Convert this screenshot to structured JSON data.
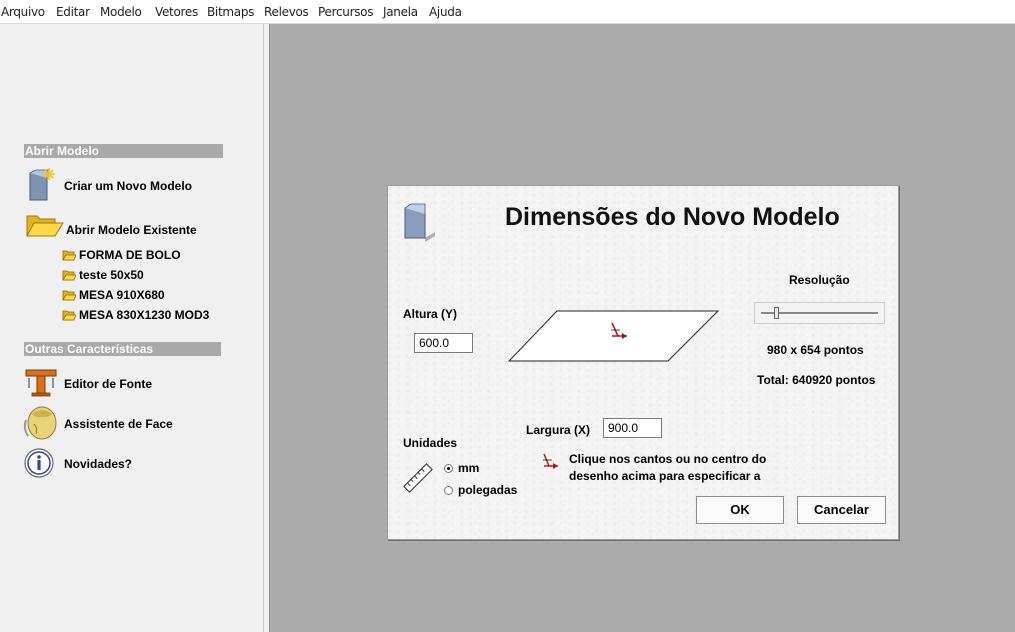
{
  "menubar": {
    "items": [
      "Arquivo",
      "Editar",
      "Modelo",
      "Vetores",
      "Bitmaps",
      "Relevos",
      "Percursos",
      "Janela",
      "Ajuda"
    ]
  },
  "side": {
    "open_section": "Abrir Modelo",
    "create_new": "Criar um Novo Modelo",
    "open_existing": "Abrir Modelo Existente",
    "recent_files": [
      "FORMA DE BOLO",
      "teste 50x50",
      "MESA 910X680",
      "MESA 830X1230 MOD3"
    ],
    "other_section": "Outras Características",
    "font_editor": "Editor de Fonte",
    "face_wizard": "Assistente de Face",
    "news": "Novidades?"
  },
  "dialog": {
    "title": "Dimensões do Novo Modelo",
    "height_label": "Altura (Y)",
    "height_value": "600.0",
    "width_label": "Largura (X)",
    "width_value": "900.0",
    "resolution_label": "Resolução",
    "resolution_slider_fraction": 0.12,
    "resolution_points": "980 x 654 pontos",
    "resolution_total": "Total: 640920 pontos",
    "units_label": "Unidades",
    "unit_options": [
      "mm",
      "polegadas"
    ],
    "unit_selected": "mm",
    "hint_line1": "Clique nos cantos ou no centro do",
    "hint_line2": "desenho acima para especificar a",
    "ok_label": "OK",
    "cancel_label": "Cancelar"
  },
  "colors": {
    "workspace": "#ababab",
    "section_header": "#a9a9a9",
    "origin_marker": "#b01010"
  }
}
